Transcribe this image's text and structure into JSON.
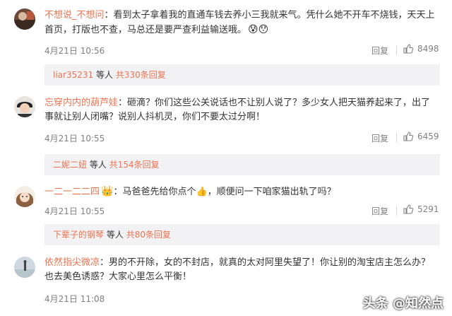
{
  "comments": [
    {
      "username": "不想说_不想问",
      "text": "看到太子拿着我的直通车钱去养小三我就来气。凭什么她不开车不烧钱，天天上首页，打版也不查，马总还是要严查利益输送哦。",
      "emoji": "😰😯",
      "date": "4月21日 10:56",
      "reply_label": "回复",
      "likes": "8498",
      "sub": {
        "user": "liar35231",
        "mid": "等人",
        "count": "共330条回复"
      }
    },
    {
      "username": "忘穿内内的葫芦娃",
      "text": "砸滴？你们这些公关说话也不让别人说了？多少女人把天猫养起来了，出了事就让别人闭嘴？说别人抖机灵，你们不要太过分啊！",
      "date": "4月21日 10:55",
      "reply_label": "回复",
      "likes": "6459",
      "sub": {
        "user": "二妮二妞",
        "mid": "等人",
        "count": "共154条回复"
      }
    },
    {
      "username": "一二一二二四",
      "badge": "👑",
      "text": "马爸爸先给你点个👍，顺便问一下咱家猫出轨了吗？",
      "date": "4月21日 10:55",
      "reply_label": "回复",
      "likes": "5291",
      "sub": {
        "user": "下辈子的钢琴",
        "mid": "等人",
        "count": "共80条回复"
      }
    },
    {
      "username": "依然指尖微凉",
      "text": "男的不开除，女的不封店，就真的太对阿里失望了！你让别的淘宝店主怎么办？也去美色诱惑？大家心里怎么平衡！",
      "date": "4月21日 11:08"
    }
  ],
  "watermark": "头条 @知然点"
}
